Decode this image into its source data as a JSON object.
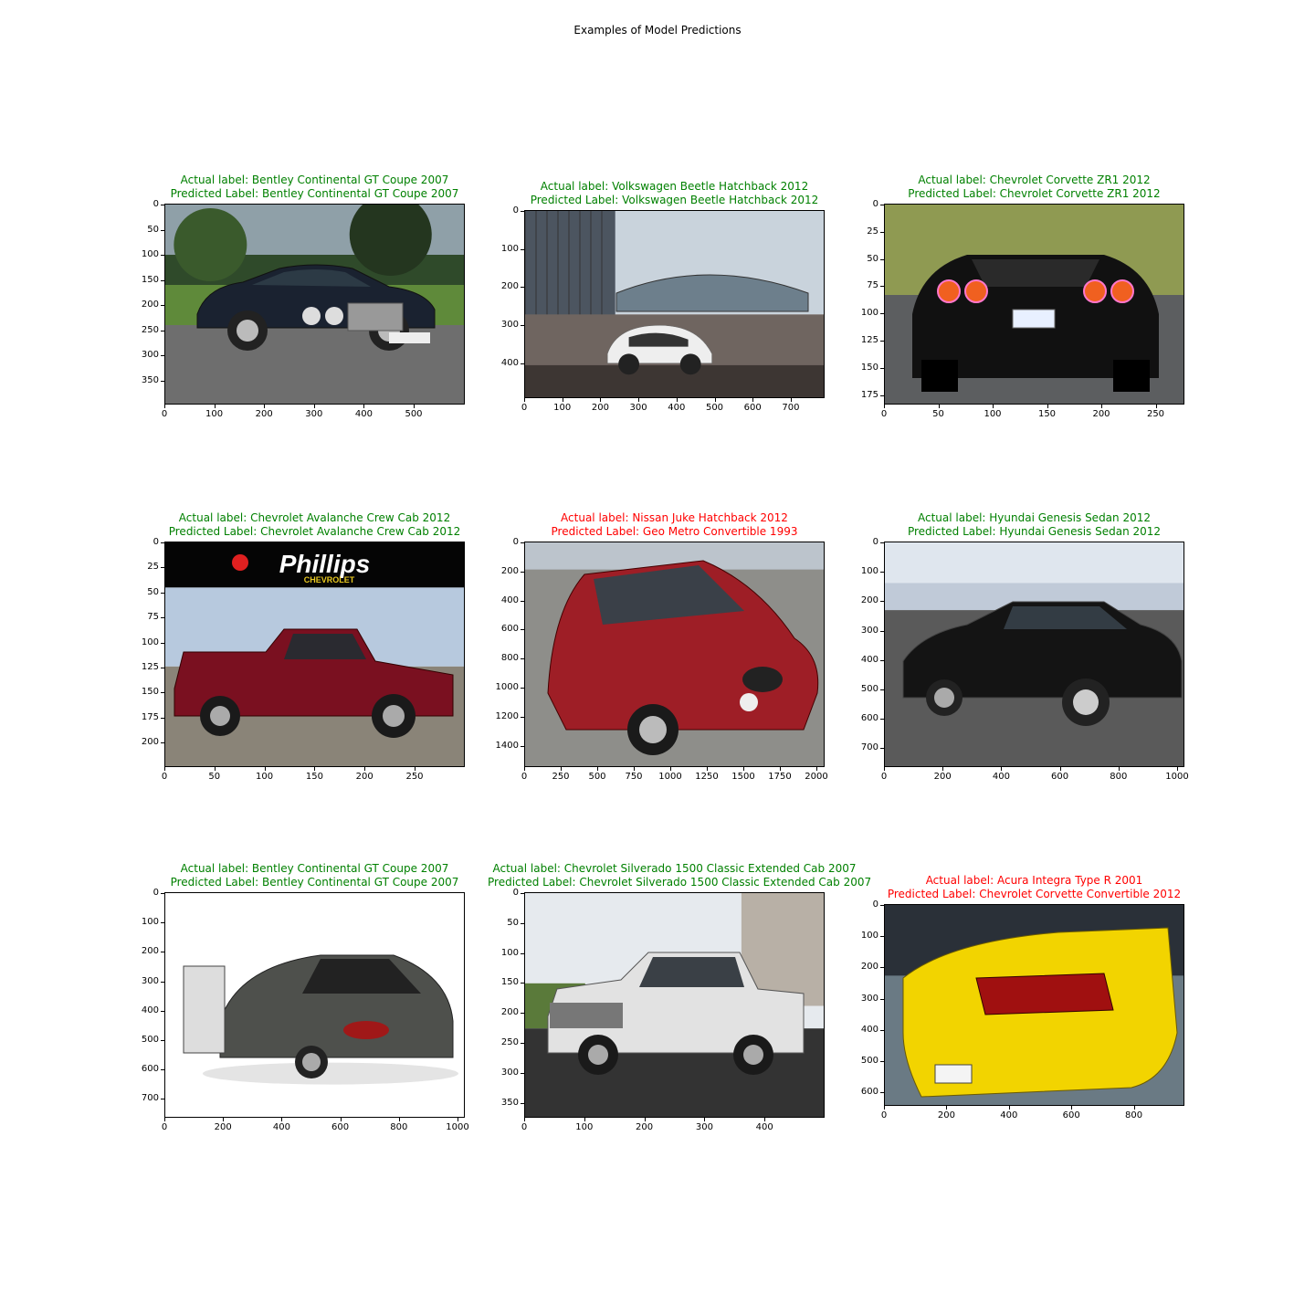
{
  "figure_title": "Examples of Model Predictions",
  "colors": {
    "correct": "#008000",
    "incorrect": "#ff0000"
  },
  "panels": [
    {
      "actual": "Actual label: Bentley Continental GT Coupe 2007",
      "predicted": "Predicted Label: Bentley Continental GT Coupe 2007",
      "correct": true,
      "scene": "bentley-front",
      "xticks": [
        "0",
        "100",
        "200",
        "300",
        "400",
        "500"
      ],
      "yticks": [
        "0",
        "50",
        "100",
        "150",
        "200",
        "250",
        "300",
        "350"
      ]
    },
    {
      "actual": "Actual label: Volkswagen Beetle Hatchback 2012",
      "predicted": "Predicted Label: Volkswagen Beetle Hatchback 2012",
      "correct": true,
      "scene": "beetle",
      "xticks": [
        "0",
        "100",
        "200",
        "300",
        "400",
        "500",
        "600",
        "700"
      ],
      "yticks": [
        "0",
        "100",
        "200",
        "300",
        "400"
      ]
    },
    {
      "actual": "Actual label: Chevrolet Corvette ZR1 2012",
      "predicted": "Predicted Label: Chevrolet Corvette ZR1 2012",
      "correct": true,
      "scene": "corvette",
      "xticks": [
        "0",
        "50",
        "100",
        "150",
        "200",
        "250"
      ],
      "yticks": [
        "0",
        "25",
        "50",
        "75",
        "100",
        "125",
        "150",
        "175"
      ]
    },
    {
      "actual": "Actual label: Chevrolet Avalanche Crew Cab 2012",
      "predicted": "Predicted Label: Chevrolet Avalanche Crew Cab 2012",
      "correct": true,
      "scene": "avalanche",
      "banner_text": "Phillips",
      "banner_sub": "CHEVROLET",
      "xticks": [
        "0",
        "50",
        "100",
        "150",
        "200",
        "250"
      ],
      "yticks": [
        "0",
        "25",
        "50",
        "75",
        "100",
        "125",
        "150",
        "175",
        "200"
      ]
    },
    {
      "actual": "Actual label: Nissan Juke Hatchback 2012",
      "predicted": "Predicted Label: Geo Metro Convertible 1993",
      "correct": false,
      "scene": "juke",
      "xticks": [
        "0",
        "250",
        "500",
        "750",
        "1000",
        "1250",
        "1500",
        "1750",
        "2000"
      ],
      "yticks": [
        "0",
        "200",
        "400",
        "600",
        "800",
        "1000",
        "1200",
        "1400"
      ]
    },
    {
      "actual": "Actual label: Hyundai Genesis Sedan 2012",
      "predicted": "Predicted Label: Hyundai Genesis Sedan 2012",
      "correct": true,
      "scene": "genesis",
      "xticks": [
        "0",
        "200",
        "400",
        "600",
        "800",
        "1000"
      ],
      "yticks": [
        "0",
        "100",
        "200",
        "300",
        "400",
        "500",
        "600",
        "700"
      ]
    },
    {
      "actual": "Actual label: Bentley Continental GT Coupe 2007",
      "predicted": "Predicted Label: Bentley Continental GT Coupe 2007",
      "correct": true,
      "scene": "bentley-rear",
      "xticks": [
        "0",
        "200",
        "400",
        "600",
        "800",
        "1000"
      ],
      "yticks": [
        "0",
        "100",
        "200",
        "300",
        "400",
        "500",
        "600",
        "700"
      ]
    },
    {
      "actual": "Actual label: Chevrolet Silverado 1500 Classic Extended Cab 2007",
      "predicted": "Predicted Label: Chevrolet Silverado 1500 Classic Extended Cab 2007",
      "correct": true,
      "scene": "silverado",
      "xticks": [
        "0",
        "100",
        "200",
        "300",
        "400"
      ],
      "yticks": [
        "0",
        "50",
        "100",
        "150",
        "200",
        "250",
        "300",
        "350"
      ]
    },
    {
      "actual": "Actual label: Acura Integra Type R 2001",
      "predicted": "Predicted Label: Chevrolet Corvette Convertible 2012",
      "correct": false,
      "scene": "integra",
      "xticks": [
        "0",
        "200",
        "400",
        "600",
        "800"
      ],
      "yticks": [
        "0",
        "100",
        "200",
        "300",
        "400",
        "500",
        "600"
      ]
    }
  ]
}
